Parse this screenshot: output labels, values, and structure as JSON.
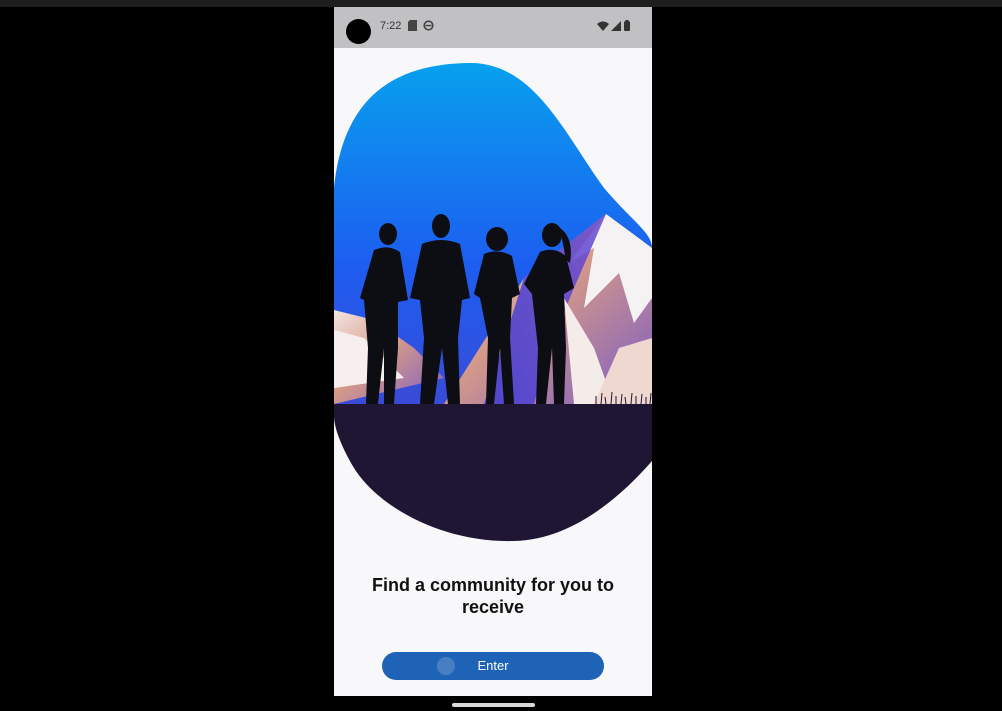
{
  "status_bar": {
    "time": "7:22",
    "left_icons": [
      "sd-card-icon",
      "data-saver-icon"
    ],
    "right_icons": [
      "wifi-icon",
      "cell-signal-icon",
      "battery-icon"
    ]
  },
  "onboarding": {
    "headline": "Find a community for you to receive",
    "enter_button_label": "Enter",
    "hero_image": "people-silhouettes-mountain-illustration"
  },
  "colors": {
    "sky_top": "#07a0ee",
    "sky_bottom": "#1d5df0",
    "ground": "#1f1633",
    "button": "#1f63b6",
    "screen_background": "#f8f8fa",
    "status_bar": "#c1c1c3"
  }
}
